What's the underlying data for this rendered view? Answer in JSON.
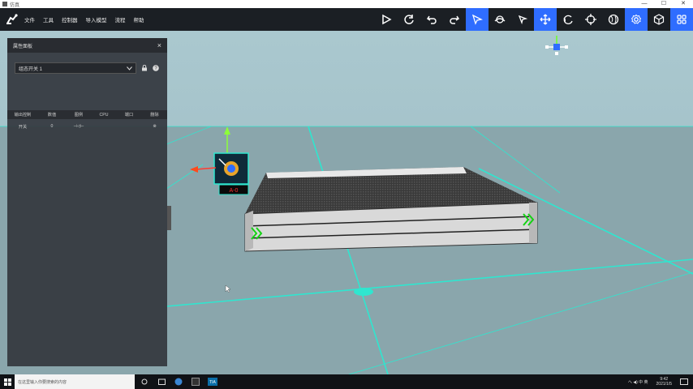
{
  "window": {
    "title": "仿真",
    "min": "—",
    "max": "☐",
    "close": "✕"
  },
  "menu": [
    "文件",
    "工具",
    "控制器",
    "导入模型",
    "流程",
    "帮助"
  ],
  "toolbar": [
    {
      "icon": "play-icon",
      "active": false
    },
    {
      "icon": "reset-icon",
      "active": false
    },
    {
      "icon": "undo-icon",
      "active": false
    },
    {
      "icon": "redo-icon",
      "active": false
    },
    {
      "icon": "select-icon",
      "active": true
    },
    {
      "icon": "orbit-icon",
      "active": false
    },
    {
      "icon": "pointer-icon",
      "active": false
    },
    {
      "icon": "move-icon",
      "active": true
    },
    {
      "icon": "rotate-icon",
      "active": false
    },
    {
      "icon": "target-icon",
      "active": false
    },
    {
      "icon": "globe-icon",
      "active": false
    },
    {
      "icon": "settings-icon",
      "active": true
    },
    {
      "icon": "cube-icon",
      "active": false
    },
    {
      "icon": "grid-icon",
      "active": true
    }
  ],
  "panel": {
    "title": "属性面板",
    "select_value": "组态开关 1",
    "columns": [
      "输出控制",
      "数值",
      "图例",
      "CPU",
      "端口",
      "删除"
    ],
    "rows": [
      {
        "c1": "开关",
        "c2": "0",
        "c3": "⊣◁⊢",
        "c4": "",
        "c5": "",
        "c6": "⊗"
      }
    ]
  },
  "scene": {
    "sensor_label": "A-0"
  },
  "taskbar": {
    "search_placeholder": "在这里输入你要搜索的内容",
    "time": "9:42",
    "date": "2021/1/5",
    "tray_text": "へ ◀) 中 英"
  },
  "colors": {
    "sky": "#a9c6cc",
    "floor": "#8ba7ad",
    "grid": "#28e0c8",
    "accent": "#2f6dff"
  }
}
